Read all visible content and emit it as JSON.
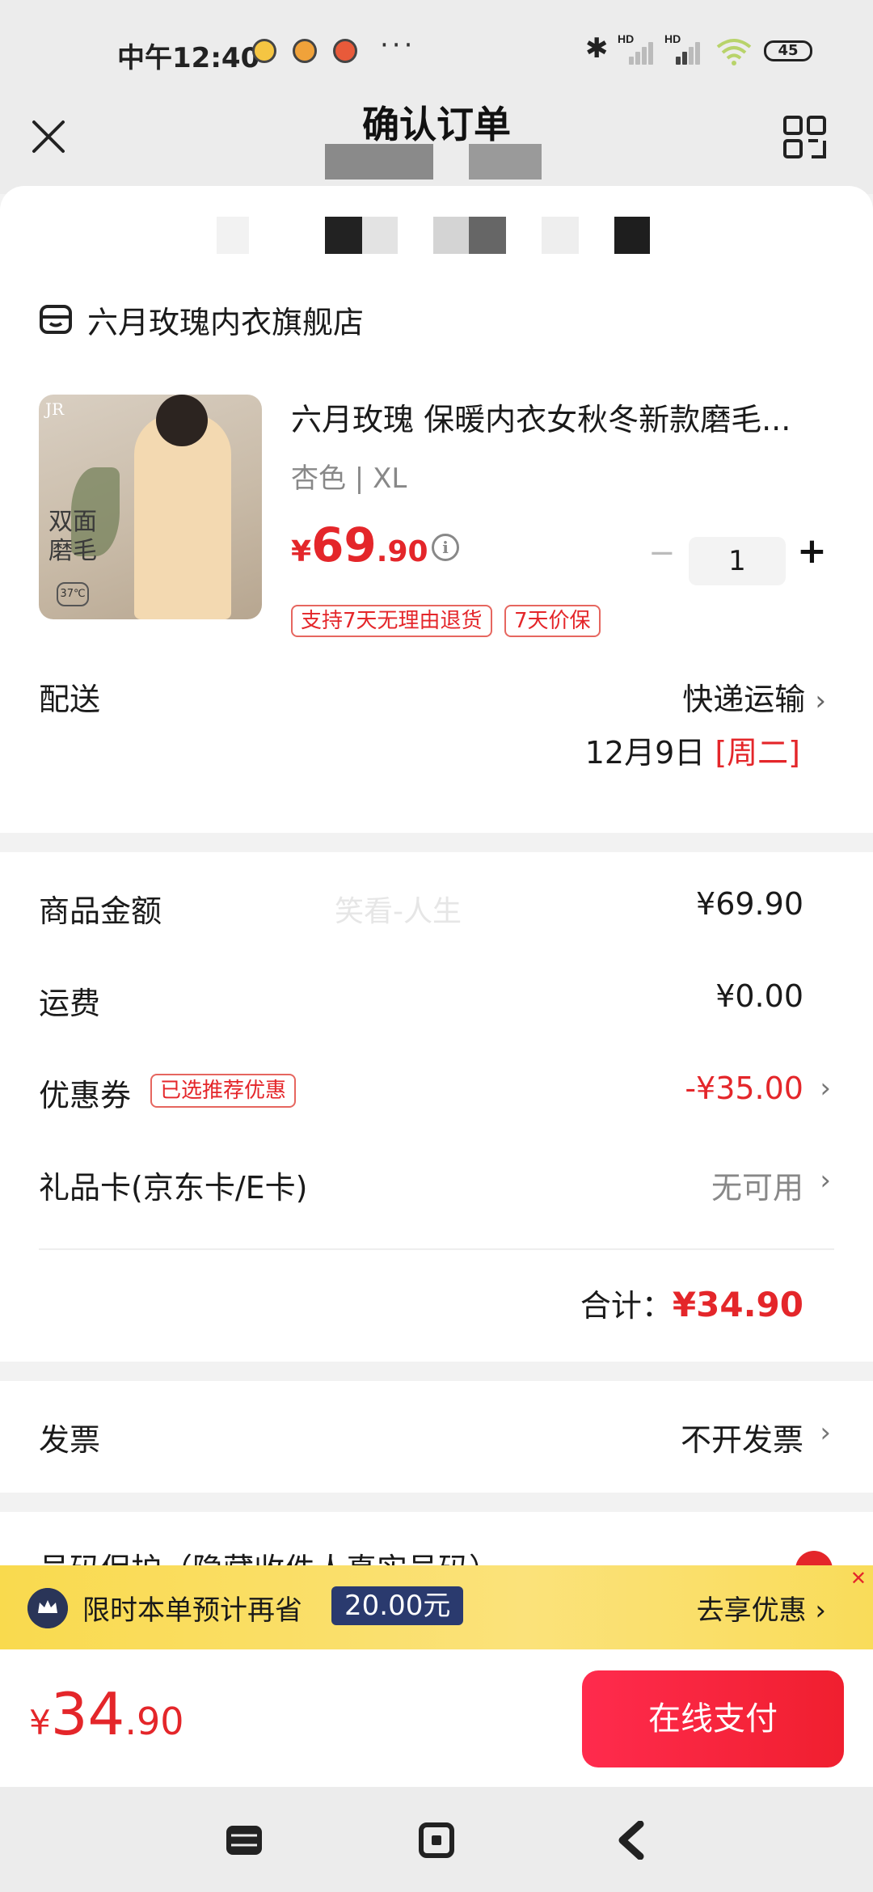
{
  "status_bar": {
    "time": "中午12:40",
    "battery": "45",
    "signal_tag": "HD"
  },
  "header": {
    "title": "确认订单"
  },
  "store": {
    "name": "六月玫瑰内衣旗舰店"
  },
  "product": {
    "title": "六月玫瑰 保暖内衣女秋冬新款磨毛...",
    "spec": "杏色 | XL",
    "price_currency": "¥",
    "price_int": "69",
    "price_dec": ".90",
    "quantity": "1",
    "qty_minus": "−",
    "qty_plus": "+",
    "tags": [
      "支持7天无理由退货",
      "7天价保"
    ],
    "image_text": "双面\n磨毛",
    "image_badge": "37℃",
    "image_logo": "JR"
  },
  "delivery": {
    "label": "配送",
    "method": "快递运输",
    "date": "12月9日",
    "weekday": "[周二]"
  },
  "amounts": {
    "watermark": "笑看-人生",
    "goods_label": "商品金额",
    "goods_value": "¥69.90",
    "shipping_label": "运费",
    "shipping_value": "¥0.00",
    "coupon_label": "优惠券",
    "coupon_tag": "已选推荐优惠",
    "coupon_value": "-¥35.00",
    "giftcard_label": "礼品卡(京东卡/E卡)",
    "giftcard_value": "无可用",
    "total_label": "合计：",
    "total_value": "¥34.90"
  },
  "invoice": {
    "label": "发票",
    "value": "不开发票"
  },
  "privacy": {
    "label": "号码保护（隐藏收件人真实号码）"
  },
  "promo": {
    "text": "限时本单预计再省",
    "amount": "20.00元",
    "action": "去享优惠",
    "close": "✕"
  },
  "pay": {
    "currency": "¥",
    "int": "34",
    "dec": ".90",
    "button": "在线支付"
  },
  "colors": {
    "accent_red": "#e4262a",
    "promo_yellow": "#f9da4e",
    "promo_badge": "#2a3a6e"
  }
}
